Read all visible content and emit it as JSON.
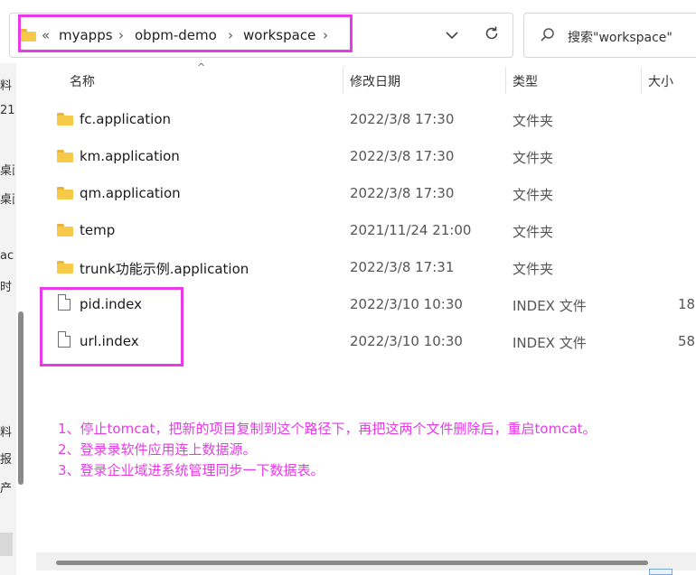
{
  "colors": {
    "annotation": "#e83ae8",
    "folder": "#f7c948"
  },
  "left_pane": {
    "fragments": [
      "料",
      "21",
      "桌面",
      "桌面",
      "ac",
      "时",
      "料",
      "报",
      "产"
    ]
  },
  "address_bar": {
    "overflow_chevron": "«",
    "crumbs": [
      "myapps",
      "obpm-demo",
      "workspace"
    ],
    "separator": "›",
    "dropdown_icon": "chevron-down-icon",
    "refresh_icon": "refresh-icon"
  },
  "search": {
    "placeholder": "搜索\"workspace\""
  },
  "columns": {
    "name": "名称",
    "modified": "修改日期",
    "type": "类型",
    "size": "大小"
  },
  "files": [
    {
      "name": "fc.application",
      "modified": "2022/3/8 17:30",
      "type": "文件夹",
      "size": "",
      "icon": "folder-icon"
    },
    {
      "name": "km.application",
      "modified": "2022/3/8 17:30",
      "type": "文件夹",
      "size": "",
      "icon": "folder-icon"
    },
    {
      "name": "qm.application",
      "modified": "2022/3/8 17:30",
      "type": "文件夹",
      "size": "",
      "icon": "folder-icon"
    },
    {
      "name": "temp",
      "modified": "2021/11/24 21:00",
      "type": "文件夹",
      "size": "",
      "icon": "folder-icon"
    },
    {
      "name": "trunk功能示例.application",
      "modified": "2022/3/8 17:31",
      "type": "文件夹",
      "size": "",
      "icon": "folder-icon"
    },
    {
      "name": "pid.index",
      "modified": "2022/3/10 10:30",
      "type": "INDEX 文件",
      "size": "18",
      "icon": "file-icon"
    },
    {
      "name": "url.index",
      "modified": "2022/3/10 10:30",
      "type": "INDEX 文件",
      "size": "58",
      "icon": "file-icon"
    }
  ],
  "notes": [
    "1、停止tomcat，把新的项目复制到这个路径下，再把这两个文件删除后，重启tomcat。",
    "2、登录录软件应用连上数据源。",
    "3、登录企业域进系统管理同步一下数据表。"
  ]
}
